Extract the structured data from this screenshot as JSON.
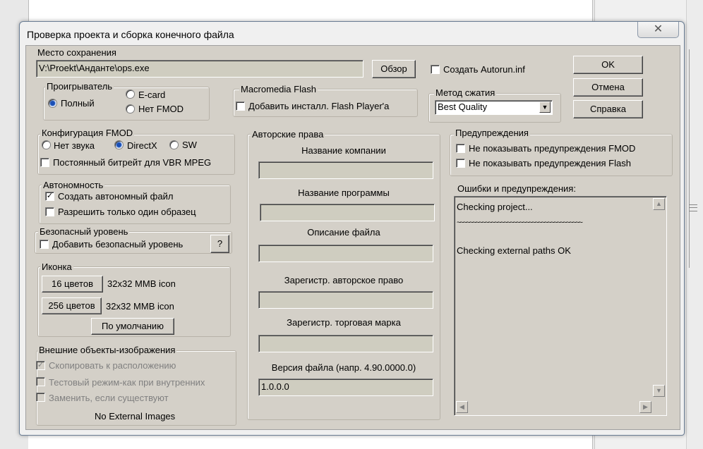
{
  "dialog": {
    "title": "Проверка проекта и сборка конечного файла",
    "close_glyph": "✕"
  },
  "save_location": {
    "group_label": "Место сохранения",
    "path": "V:\\Proekt\\Анданте\\ops.exe",
    "browse_label": "Обзор",
    "autorun_label": "Создать Autorun.inf",
    "autorun_checked": false
  },
  "dialog_buttons": {
    "ok": "OK",
    "cancel": "Отмена",
    "help": "Справка"
  },
  "player": {
    "group_label": "Проигрыватель",
    "options": [
      "Полный",
      "E-card",
      "Нет FMOD"
    ],
    "selected": "Полный"
  },
  "flash": {
    "group_label": "Macromedia Flash",
    "add_installer_label": "Добавить инсталл. Flash Player'a",
    "checked": false
  },
  "compression": {
    "group_label": "Метод сжатия",
    "selected": "Best Quality"
  },
  "fmod_config": {
    "group_label": "Конфигурация FMOD",
    "options": [
      "Нет звука",
      "DirectX",
      "SW"
    ],
    "selected": "DirectX",
    "constant_bitrate_label": "Постоянный битрейт для VBR MPEG",
    "constant_bitrate_checked": false
  },
  "autonomy": {
    "group_label": "Автономность",
    "create_standalone_label": "Создать автономный файл",
    "create_standalone_checked": true,
    "single_instance_label": "Разрешить только один образец",
    "single_instance_checked": false
  },
  "security": {
    "group_label": "Безопасный уровень",
    "add_level_label": "Добавить безопасный уровень",
    "checked": false,
    "help_label": "?"
  },
  "icon": {
    "group_label": "Иконка",
    "btn_16_label": "16 цветов",
    "btn_16_value": "32x32 MMB icon",
    "btn_256_label": "256 цветов",
    "btn_256_value": "32x32 MMB icon",
    "default_label": "По умолчанию"
  },
  "external_images": {
    "group_label": "Внешние объекты-изображения",
    "copy_label": "Скопировать к расположению",
    "copy_checked": true,
    "test_mode_label": "Тестовый режим-как при внутренних",
    "replace_label": "Заменить, если существуют",
    "status": "No External Images"
  },
  "copyright": {
    "group_label": "Авторские права",
    "company_label": "Название компании",
    "company_value": "",
    "program_label": "Название программы",
    "program_value": "",
    "description_label": "Описание файла",
    "description_value": "",
    "reg_copyright_label": "Зарегистр. авторское право",
    "reg_copyright_value": "",
    "reg_trademark_label": "Зарегистр. торговая марка",
    "reg_trademark_value": "",
    "version_label": "Версия файла (напр. 4.90.0000.0)",
    "version_value": "1.0.0.0"
  },
  "warnings": {
    "group_label": "Предупреждения",
    "hide_fmod_label": "Не показывать предупреждения FMOD",
    "hide_flash_label": "Не показывать предупреждения Flash",
    "hide_fmod_checked": false,
    "hide_flash_checked": false
  },
  "log": {
    "label": "Ошибки и предупреждения:",
    "lines": [
      "Checking project...",
      "~~~~~~~~~~~~~~~~~~~~~~~~~~~~~~~~~~~~~~~~",
      "Checking external paths OK"
    ]
  }
}
